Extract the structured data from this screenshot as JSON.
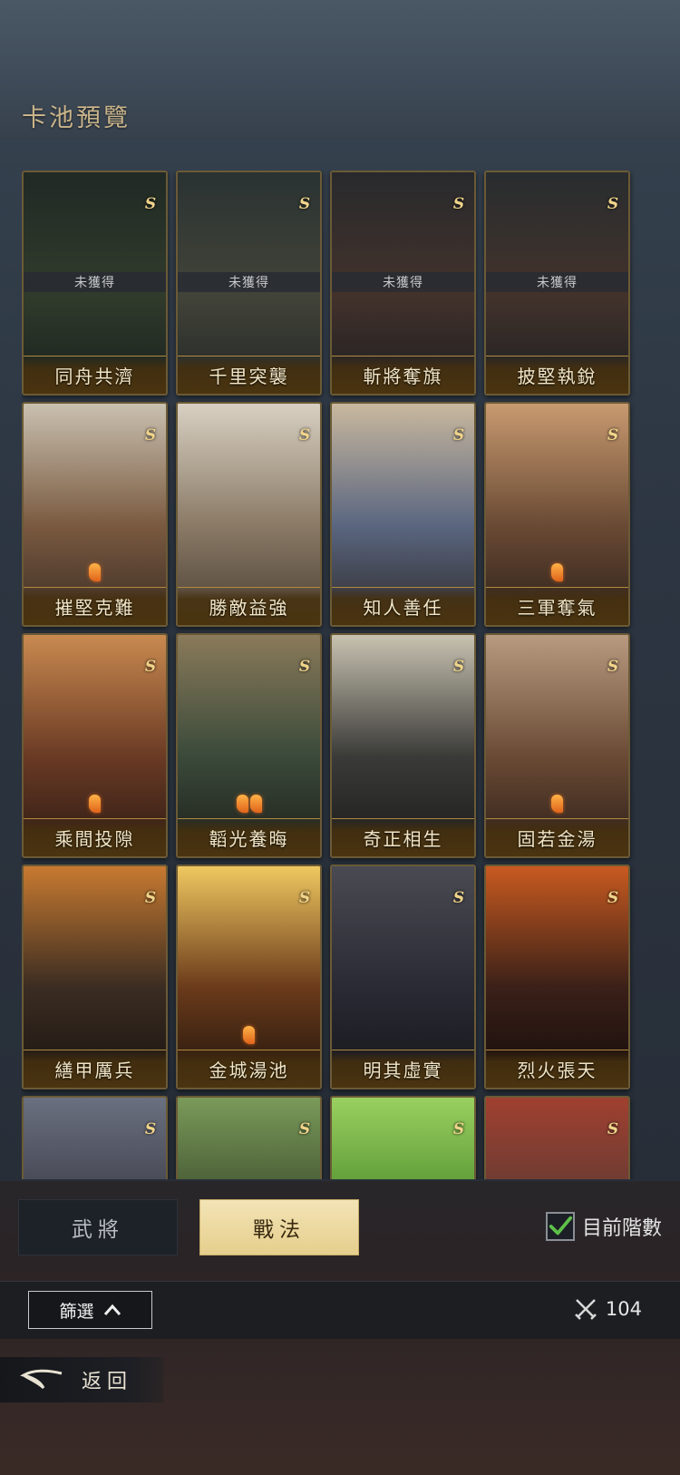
{
  "header": {
    "title": "卡池預覽"
  },
  "cards": [
    {
      "name": "同舟共濟",
      "status": "未獲得",
      "marks": 0,
      "art": [
        "#2b3a2e",
        "#4a5a3a",
        "#1e2a22"
      ]
    },
    {
      "name": "千里突襲",
      "status": "未獲得",
      "marks": 0,
      "art": [
        "#3c4a46",
        "#6a6a52",
        "#2e3530"
      ]
    },
    {
      "name": "斬將奪旗",
      "status": "未獲得",
      "marks": 0,
      "art": [
        "#3a3a3c",
        "#6a4a3a",
        "#262628"
      ]
    },
    {
      "name": "披堅執銳",
      "status": "未獲得",
      "marks": 0,
      "art": [
        "#3a4040",
        "#6a4a3a",
        "#262a2a"
      ]
    },
    {
      "name": "摧堅克難",
      "status": "",
      "marks": 1,
      "art": [
        "#c9c0b0",
        "#7a5a40",
        "#3a2c24"
      ]
    },
    {
      "name": "勝敵益強",
      "status": "",
      "marks": 0,
      "art": [
        "#d8d0c2",
        "#8a7a66",
        "#4a3e34"
      ]
    },
    {
      "name": "知人善任",
      "status": "",
      "marks": 0,
      "art": [
        "#c9b89e",
        "#5a6680",
        "#2e2a2a"
      ]
    },
    {
      "name": "三軍奪氣",
      "status": "",
      "marks": 1,
      "art": [
        "#c89a70",
        "#6a4a34",
        "#2a201a"
      ]
    },
    {
      "name": "乘間投隙",
      "status": "",
      "marks": 1,
      "art": [
        "#c98a50",
        "#6a3a24",
        "#2a1a14"
      ]
    },
    {
      "name": "韜光養晦",
      "status": "",
      "marks": 2,
      "art": [
        "#8a7a5a",
        "#3a4a3a",
        "#1e1e1a"
      ]
    },
    {
      "name": "奇正相生",
      "status": "",
      "marks": 0,
      "art": [
        "#c8c2b0",
        "#3a3a38",
        "#1a1a1a"
      ]
    },
    {
      "name": "固若金湯",
      "status": "",
      "marks": 1,
      "art": [
        "#b89a80",
        "#6a4a34",
        "#2a1e18"
      ]
    },
    {
      "name": "繕甲厲兵",
      "status": "",
      "marks": 0,
      "art": [
        "#c87a30",
        "#3a2c22",
        "#1a1410"
      ]
    },
    {
      "name": "金城湯池",
      "status": "",
      "marks": 1,
      "art": [
        "#f0c860",
        "#6a3a1a",
        "#1e140c"
      ]
    },
    {
      "name": "明其虛實",
      "status": "",
      "marks": 0,
      "art": [
        "#4a4a52",
        "#2a2a34",
        "#15151a"
      ]
    },
    {
      "name": "烈火張天",
      "status": "",
      "marks": 0,
      "art": [
        "#c85a20",
        "#3a2018",
        "#140c0a"
      ]
    },
    {
      "name": "",
      "status": "",
      "marks": 0,
      "art": [
        "#6a7080",
        "#3a3a44",
        "#202228"
      ]
    },
    {
      "name": "",
      "status": "",
      "marks": 0,
      "art": [
        "#7a9a5a",
        "#3a4a2a",
        "#1e2418"
      ]
    },
    {
      "name": "",
      "status": "",
      "marks": 0,
      "art": [
        "#9ad060",
        "#4a8a2a",
        "#2a3a1a"
      ]
    },
    {
      "name": "",
      "status": "",
      "marks": 0,
      "art": [
        "#a04030",
        "#5a3a34",
        "#2a2220"
      ]
    }
  ],
  "card_corner_glyph": "S",
  "tabs": {
    "generals": "武將",
    "tactics": "戰法",
    "selected": "tactics"
  },
  "current_rank": {
    "label": "目前階數",
    "checked": true
  },
  "filter": {
    "label": "篩選"
  },
  "count": {
    "value": "104",
    "icon": "crossed-swords-icon"
  },
  "back": {
    "label": "返回"
  },
  "colors": {
    "accent_gold": "#e6cf8d",
    "check_green": "#5ec24a"
  }
}
